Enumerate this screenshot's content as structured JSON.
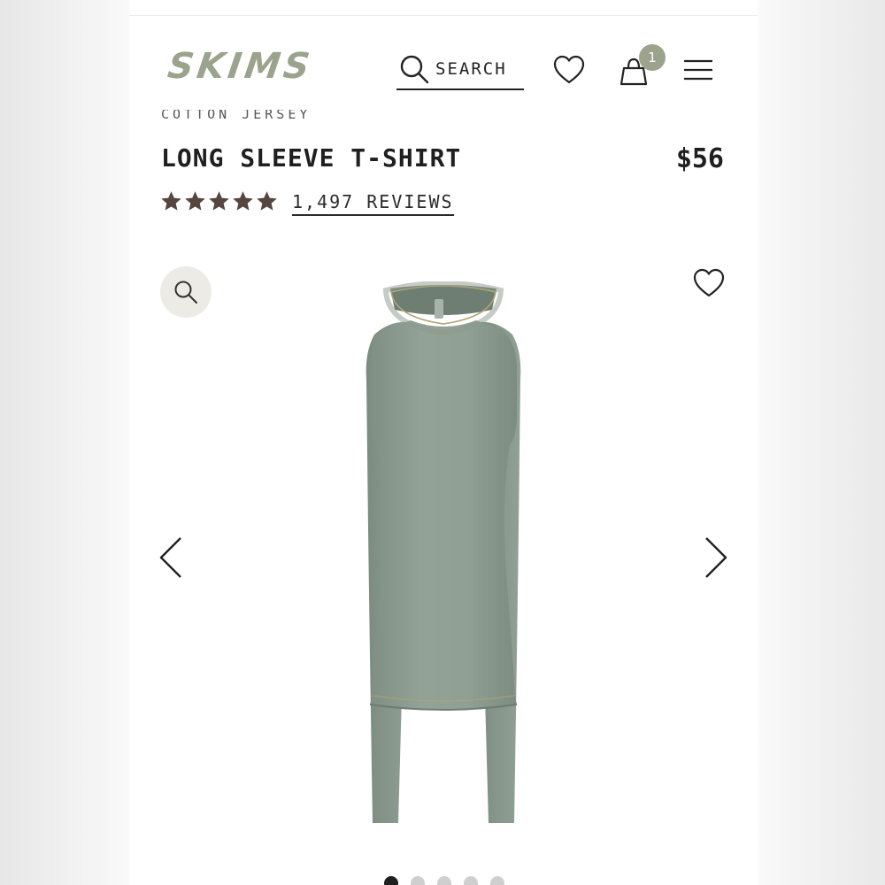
{
  "brand": {
    "logo": "SKIMS",
    "accent_color": "#9aa48d"
  },
  "header": {
    "search_label": "SEARCH",
    "cart_count": "1",
    "icons": [
      "search-icon",
      "heart-icon",
      "bag-icon",
      "menu-icon"
    ]
  },
  "product": {
    "collection": "COTTON JERSEY",
    "title": "LONG SLEEVE T-SHIRT",
    "price": "$56",
    "rating": 5,
    "reviews_label": "1,497 REVIEWS",
    "image_color": "#8f9e92"
  },
  "gallery": {
    "icons": [
      "zoom-icon",
      "favorite-icon",
      "chevron-left-icon",
      "chevron-right-icon"
    ],
    "total_slides": 5,
    "active_slide": 1
  }
}
